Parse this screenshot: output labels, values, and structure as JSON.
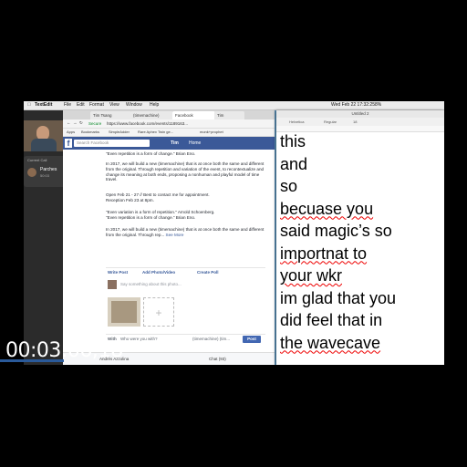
{
  "menubar": {
    "app": "TextEdit",
    "items": [
      "File",
      "Edit",
      "Format",
      "View",
      "Window",
      "Help"
    ],
    "clock": "Wed Feb 22  17:32:25",
    "battery": "8% "
  },
  "facetime": {
    "label": "Current Call",
    "caller": "Parches",
    "duration": "50:03"
  },
  "browser": {
    "tabs": [
      "Tim Tsang",
      "(timemachine)",
      "Facebook",
      "Tim"
    ],
    "secure_label": "Secure",
    "url": "https://www.facebook.com/events/1189163...",
    "bookmarks": [
      "Apps",
      "Bookmarks",
      "SimpleAdder",
      "Rare Aphex Twin ge...",
      "monk+prophet"
    ],
    "fb_search_placeholder": "Search Facebook",
    "fb_user": "Tim",
    "fb_home": "Home",
    "post_lines": [
      "\"Even repetition is a form of change.\" Brian Eno.",
      "In 2017, we will build a new (timemachine) that is at once both the same and different from the original. Through repetition and variation of the event, to recontextualize and change its meaning at both ends, proposing a nonhuman and playful model of time travel.",
      "Open Feb 21 - 27 // Best to contact me for appointment.",
      "Reception Feb 23 at 8pm.",
      "\"Even variation is a form of repetition.\" Arnold Schoenberg.",
      "\"Even repetition is a form of change.\" Brian Eno.",
      "In 2017, we will build a new (timemachine) that is at once both the same and different from the original. Through rep..."
    ],
    "see_more": "See More",
    "actions": [
      "Write Post",
      "Add Photo/Video",
      "Create Poll"
    ],
    "composer_placeholder": "Say something about this photo...",
    "with_label": "With",
    "with_placeholder": "Who were you with?",
    "post_target": "(timemachine) (tim...",
    "post_button": "Post",
    "bottom_user": "Andrés Azzolina",
    "chat_label": "Chat (93)"
  },
  "textedit": {
    "window_title": "Untitled 2",
    "font_name": "Helvetica",
    "font_style": "Regular",
    "font_size": "18",
    "lines": [
      "this",
      "and",
      "so",
      "becuase you",
      "said magic’s so",
      "importnat to",
      "your wkr",
      "im glad that you",
      "did feel that in",
      "the wavecave"
    ]
  },
  "timecode": "00:03:06;18",
  "colors": {
    "facebook_blue": "#3b5998",
    "desktop": "#5a8fb5",
    "spell_underline": "#e00000"
  }
}
